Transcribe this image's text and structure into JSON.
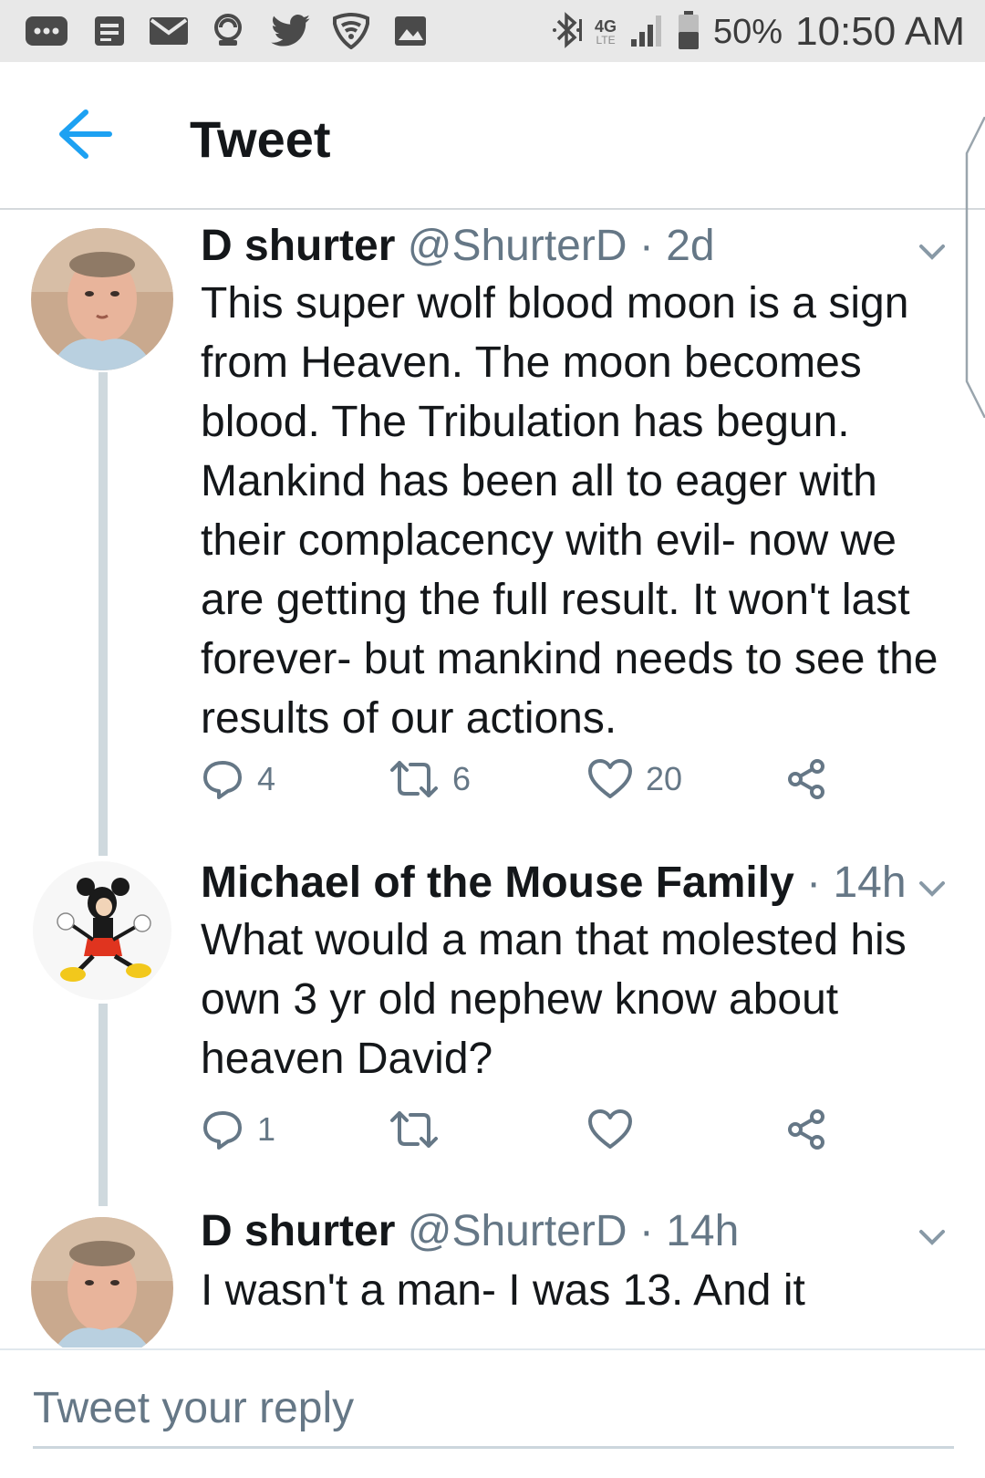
{
  "status_bar": {
    "icons": [
      "more-icon",
      "note-icon",
      "mail-icon",
      "shield-icon",
      "twitter-icon",
      "wifi-shield-icon",
      "image-icon",
      "bluetooth-icon",
      "signal-icon"
    ],
    "network": "4G",
    "network_sub": "LTE",
    "battery_percent": "50%",
    "time": "10:50 AM"
  },
  "header": {
    "title": "Tweet",
    "back_icon": "back-arrow-icon",
    "accent_color": "#1da1f2"
  },
  "tweets": [
    {
      "name": "D shurter",
      "handle": "@ShurterD",
      "separator": "·",
      "time": "2d",
      "text": "This super wolf blood moon is a sign from Heaven. The moon becomes blood. The Tribulation has begun. Mankind has been all to eager with their complacency with evil- now we are getting the full result. It won't last forever- but mankind needs to see the results of our actions.",
      "replies": "4",
      "retweets": "6",
      "likes": "20"
    },
    {
      "name": "Michael of the Mouse Family",
      "handle": "",
      "separator": "·",
      "time": "14h",
      "text": "What would a man that molested his own 3 yr old nephew know about heaven David?",
      "replies": "1",
      "retweets": "",
      "likes": ""
    },
    {
      "name": "D shurter",
      "handle": "@ShurterD",
      "separator": "·",
      "time": "14h",
      "text": "I wasn't a man- I was 13. And it",
      "replies": "",
      "retweets": "",
      "likes": ""
    }
  ],
  "reply_bar": {
    "placeholder": "Tweet your reply"
  }
}
